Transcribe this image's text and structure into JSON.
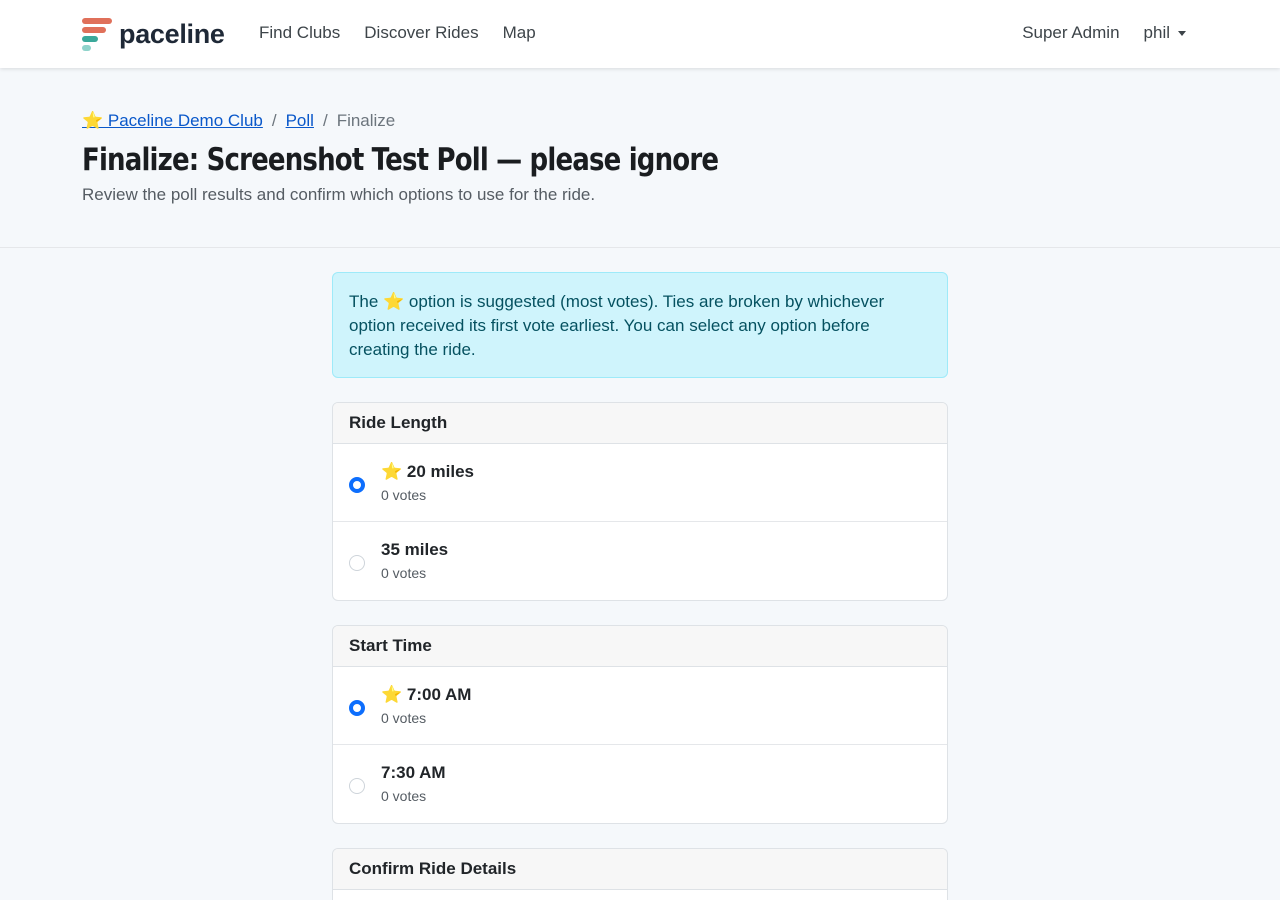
{
  "navbar": {
    "brand": "paceline",
    "links": [
      "Find Clubs",
      "Discover Rides",
      "Map"
    ],
    "admin_label": "Super Admin",
    "user_label": "phil"
  },
  "breadcrumb": {
    "club": "⭐ Paceline Demo Club",
    "separator": "/",
    "poll": "Poll",
    "current": "Finalize"
  },
  "page": {
    "title": "Finalize: Screenshot Test Poll — please ignore",
    "subtitle": "Review the poll results and confirm which options to use for the ride."
  },
  "alert": {
    "text": "The ⭐ option is suggested (most votes). Ties are broken by whichever option received its first vote earliest. You can select any option before creating the ride."
  },
  "sections": [
    {
      "title": "Ride Length",
      "options": [
        {
          "label": "⭐ 20 miles",
          "votes": "0 votes",
          "selected": true
        },
        {
          "label": "35 miles",
          "votes": "0 votes",
          "selected": false
        }
      ]
    },
    {
      "title": "Start Time",
      "options": [
        {
          "label": "⭐ 7:00 AM",
          "votes": "0 votes",
          "selected": true
        },
        {
          "label": "7:30 AM",
          "votes": "0 votes",
          "selected": false
        }
      ]
    }
  ],
  "confirm": {
    "title": "Confirm Ride Details"
  },
  "colors": {
    "accent": "#0d6efd",
    "alert_bg": "#cff4fc",
    "logo_coral": "#e0705a",
    "logo_teal": "#3aa89a"
  }
}
